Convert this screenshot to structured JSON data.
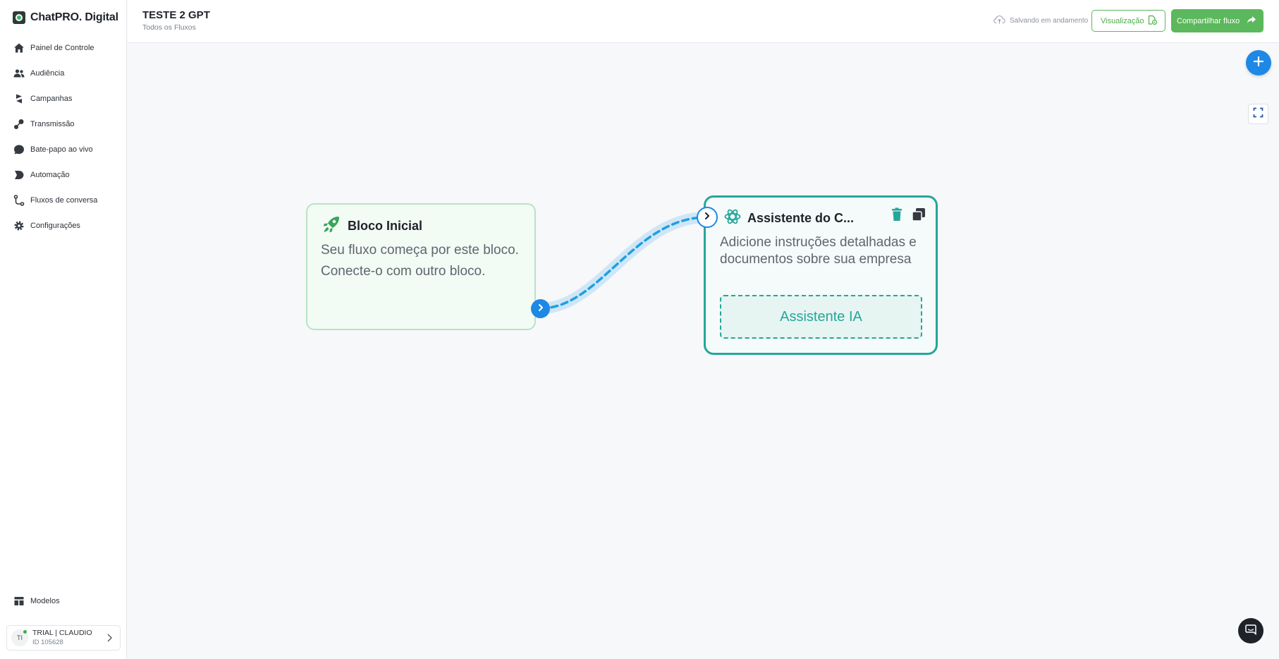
{
  "brand": {
    "name": "ChatPRO. Digital"
  },
  "sidebar": {
    "items": [
      {
        "label": "Painel de Controle",
        "icon": "home-icon"
      },
      {
        "label": "Audiência",
        "icon": "users-icon"
      },
      {
        "label": "Campanhas",
        "icon": "campaign-icon"
      },
      {
        "label": "Transmissão",
        "icon": "broadcast-icon"
      },
      {
        "label": "Bate-papo ao vivo",
        "icon": "chat-icon"
      },
      {
        "label": "Automação",
        "icon": "automation-icon"
      },
      {
        "label": "Fluxos de conversa",
        "icon": "flow-icon"
      },
      {
        "label": "Configurações",
        "icon": "gear-icon"
      }
    ],
    "bottom": {
      "label": "Modelos",
      "icon": "templates-icon"
    },
    "user": {
      "initials": "TI",
      "name": "TRIAL | CLAUDIO",
      "id": "ID 105628"
    }
  },
  "header": {
    "title": "TESTE 2 GPT",
    "breadcrumb": "Todos os Fluxos",
    "saving_status": "Salvando em andamento",
    "preview_label": "Visualização",
    "share_label": "Compartilhar fluxo"
  },
  "canvas": {
    "start_block": {
      "title": "Bloco Inicial",
      "description": "Seu fluxo começa por este bloco. Conecte-o com outro bloco."
    },
    "ai_block": {
      "title": "Assistente do C...",
      "description": "Adicione instruções detalhadas e documentos sobre sua empresa",
      "button_label": "Assistente IA"
    }
  },
  "colors": {
    "accent_green": "#5cb85c",
    "accent_blue": "#1e88e5",
    "ai_teal": "#26a69a"
  }
}
